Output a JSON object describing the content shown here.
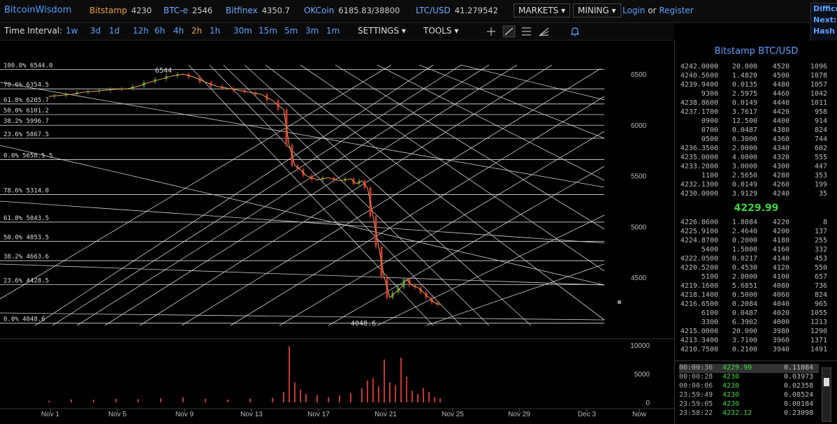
{
  "topbar": {
    "brand": "BitcoinWisdom",
    "exchanges": [
      {
        "name": "Bitstamp",
        "value": "4230",
        "color": "#e8a33a"
      },
      {
        "name": "BTC-e",
        "value": "2546",
        "color": "#6fa8ff"
      },
      {
        "name": "Bitfinex",
        "value": "4350.7",
        "color": "#6fa8ff"
      },
      {
        "name": "OKCoin",
        "value": "6185.83/38800",
        "color": "#6fa8ff"
      },
      {
        "name": "LTC/USD",
        "value": "41.279542",
        "color": "#6fa8ff"
      }
    ],
    "markets_label": "MARKETS",
    "mining_label": "MINING",
    "login_label": "Login",
    "or_label": "or",
    "register_label": "Register",
    "right_info": [
      "Difficu",
      "Next:",
      "Hash R"
    ]
  },
  "toolbar": {
    "interval_label": "Time Interval:",
    "intervals": [
      "1w",
      "3d",
      "1d",
      "12h",
      "6h",
      "4h",
      "2h",
      "1h",
      "30m",
      "15m",
      "5m",
      "3m",
      "1m"
    ],
    "selected_interval": "2h",
    "settings_label": "SETTINGS",
    "tools_label": "TOOLS",
    "tool_icons": [
      "crosshair-icon",
      "line-draw-icon",
      "fibonacci-icon",
      "fan-icon",
      "alert-bell-icon"
    ]
  },
  "chart_data": {
    "type": "line",
    "price_axis": {
      "ticks": [
        6500,
        6000,
        5500,
        5000,
        4500
      ],
      "labels": [
        "6500",
        "6000",
        "5500",
        "5000",
        "4500"
      ]
    },
    "volume_axis": {
      "ticks": [
        10000,
        5000,
        0
      ],
      "labels": [
        "10000",
        "5000",
        "0"
      ]
    },
    "x_labels": [
      "Nov 1",
      "Nov 5",
      "Nov 9",
      "Nov 13",
      "Nov 17",
      "Nov 21",
      "Nov 25",
      "Nov 29",
      "Dec 3",
      "Now"
    ],
    "fib_upper": [
      {
        "label": "100.0% 6544.0",
        "price": 6544.0
      },
      {
        "label": "78.6% 6354.5",
        "price": 6354.5
      },
      {
        "label": "61.8% 6205.7",
        "price": 6205.7
      },
      {
        "label": "50.0% 6101.2",
        "price": 6101.2
      },
      {
        "label": "38.2% 5996.7",
        "price": 5996.7
      },
      {
        "label": "23.6% 5867.5",
        "price": 5867.5
      },
      {
        "label": "0.0% 5658.5 5",
        "price": 5658.5
      }
    ],
    "fib_lower": [
      {
        "label": "78.6% 5314.0",
        "price": 5314.0
      },
      {
        "label": "61.8% 5043.5",
        "price": 5043.5
      },
      {
        "label": "50.0% 4853.5",
        "price": 4853.5
      },
      {
        "label": "38.2% 4663.6",
        "price": 4663.6
      },
      {
        "label": "23.6% 4428.5",
        "price": 4428.5
      },
      {
        "label": "0.0% 4048.6",
        "price": 4048.6
      }
    ],
    "high_marker": "6544",
    "low_marker": "4048.6",
    "price_series": [
      [
        0,
        6280
      ],
      [
        2,
        6290
      ],
      [
        4,
        6300
      ],
      [
        6,
        6320
      ],
      [
        8,
        6330
      ],
      [
        10,
        6340
      ],
      [
        12,
        6350
      ],
      [
        14,
        6355
      ],
      [
        16,
        6380
      ],
      [
        18,
        6420
      ],
      [
        20,
        6450
      ],
      [
        22,
        6480
      ],
      [
        24,
        6500
      ],
      [
        26,
        6470
      ],
      [
        28,
        6420
      ],
      [
        30,
        6380
      ],
      [
        32,
        6360
      ],
      [
        34,
        6340
      ],
      [
        36,
        6320
      ],
      [
        38,
        6300
      ],
      [
        40,
        6240
      ],
      [
        42,
        6150
      ],
      [
        43,
        5800
      ],
      [
        44,
        5600
      ],
      [
        45,
        5560
      ],
      [
        46,
        5500
      ],
      [
        48,
        5460
      ],
      [
        50,
        5480
      ],
      [
        52,
        5450
      ],
      [
        54,
        5470
      ],
      [
        55,
        5420
      ],
      [
        56,
        5450
      ],
      [
        57,
        5380
      ],
      [
        58,
        5100
      ],
      [
        59,
        4800
      ],
      [
        60,
        4500
      ],
      [
        61,
        4300
      ],
      [
        62,
        4350
      ],
      [
        63,
        4400
      ],
      [
        64,
        4480
      ],
      [
        65,
        4420
      ],
      [
        66,
        4400
      ],
      [
        67,
        4350
      ],
      [
        68,
        4300
      ],
      [
        69,
        4250
      ],
      [
        70,
        4230
      ]
    ],
    "volume_series": [
      [
        0,
        300
      ],
      [
        4,
        500
      ],
      [
        8,
        450
      ],
      [
        12,
        600
      ],
      [
        16,
        550
      ],
      [
        20,
        700
      ],
      [
        24,
        900
      ],
      [
        28,
        600
      ],
      [
        32,
        500
      ],
      [
        36,
        650
      ],
      [
        40,
        800
      ],
      [
        42,
        1800
      ],
      [
        43,
        9800
      ],
      [
        44,
        3500
      ],
      [
        45,
        2200
      ],
      [
        46,
        1500
      ],
      [
        48,
        1300
      ],
      [
        50,
        900
      ],
      [
        52,
        1200
      ],
      [
        54,
        1600
      ],
      [
        56,
        2500
      ],
      [
        57,
        3800
      ],
      [
        58,
        4200
      ],
      [
        59,
        2800
      ],
      [
        60,
        7500
      ],
      [
        61,
        3500
      ],
      [
        62,
        3000
      ],
      [
        63,
        7800
      ],
      [
        64,
        4500
      ],
      [
        65,
        2000
      ],
      [
        66,
        1500
      ],
      [
        67,
        2500
      ],
      [
        68,
        1800
      ],
      [
        69,
        900
      ],
      [
        70,
        700
      ]
    ]
  },
  "orderbook": {
    "title": "Bitstamp BTC/USD",
    "asks": [
      [
        "4242.0000",
        "20.000",
        "4520",
        "1096"
      ],
      [
        "4240.5600",
        "1.4820",
        "4500",
        "1078"
      ],
      [
        "4239.9400",
        "0.0135",
        "4480",
        "1057"
      ],
      [
        "9300",
        "2.5975",
        "4460",
        "1042"
      ],
      [
        "4238.8600",
        "0.0149",
        "4440",
        "1011"
      ],
      [
        "4237.1700",
        "3.7617",
        "4420",
        "958"
      ],
      [
        "0900",
        "12.500",
        "4400",
        "914"
      ],
      [
        "0700",
        "0.0487",
        "4380",
        "824"
      ],
      [
        "0500",
        "0.3000",
        "4360",
        "744"
      ],
      [
        "4236.3500",
        "2.0000",
        "4340",
        "602"
      ],
      [
        "4235.0000",
        "4.0000",
        "4320",
        "555"
      ],
      [
        "4233.2000",
        "3.0000",
        "4300",
        "447"
      ],
      [
        "1100",
        "2.5650",
        "4280",
        "353"
      ],
      [
        "4232.1300",
        "0.0149",
        "4260",
        "199"
      ],
      [
        "4230.0000",
        "3.9129",
        "4240",
        "35"
      ]
    ],
    "last_price": "4229.99",
    "bids": [
      [
        "4226.8600",
        "1.8084",
        "4220",
        "8"
      ],
      [
        "4225.9100",
        "2.4640",
        "4200",
        "137"
      ],
      [
        "4224.8700",
        "0.2000",
        "4180",
        "255"
      ],
      [
        "5400",
        "1.5000",
        "4160",
        "332"
      ],
      [
        "4222.0500",
        "0.0217",
        "4140",
        "453"
      ],
      [
        "4220.5200",
        "0.4530",
        "4120",
        "550"
      ],
      [
        "5100",
        "2.0000",
        "4100",
        "657"
      ],
      [
        "4219.1600",
        "5.6851",
        "4080",
        "736"
      ],
      [
        "4218.1400",
        "0.5000",
        "4060",
        "824"
      ],
      [
        "4216.6500",
        "0.2084",
        "4040",
        "965"
      ],
      [
        "6100",
        "0.0487",
        "4020",
        "1055"
      ],
      [
        "3300",
        "6.3902",
        "4000",
        "1213"
      ],
      [
        "4215.0000",
        "20.000",
        "3980",
        "1290"
      ],
      [
        "4213.3400",
        "3.7100",
        "3960",
        "1371"
      ],
      [
        "4210.7500",
        "0.2100",
        "3940",
        "1491"
      ]
    ],
    "trades": [
      [
        "00:00:36",
        "4229.99",
        "0.11084"
      ],
      [
        "00:00:28",
        "4230",
        "0.03973"
      ],
      [
        "00:00:06",
        "4230",
        "0.02358"
      ],
      [
        "23:59:49",
        "4230",
        "0.08524"
      ],
      [
        "23:59:05",
        "4230",
        "0.00184"
      ],
      [
        "23:58:22",
        "4232.12",
        "0.23098"
      ]
    ]
  }
}
